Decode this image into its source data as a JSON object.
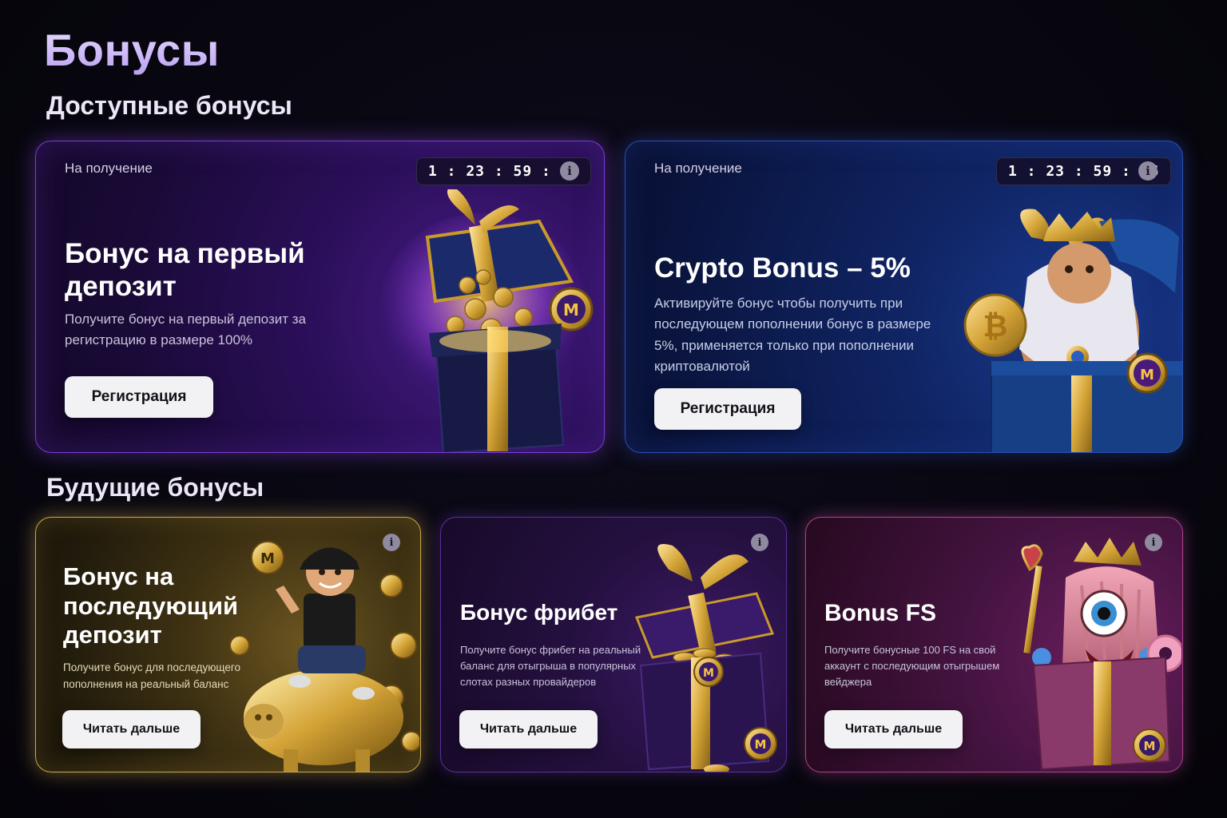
{
  "page": {
    "title": "Бонусы",
    "sections": {
      "available": "Доступные бонусы",
      "future": "Будущие бонусы"
    }
  },
  "available_bonuses": [
    {
      "status": "На получение",
      "timer": "1 : 23 : 59 : 56",
      "title": "Бонус на первый депозит",
      "description": "Получите бонус на первый депозит за регистрацию в размере 100%",
      "button": "Регистрация",
      "art_icon": "gift-box-coins-icon"
    },
    {
      "status": "На получение",
      "timer": "1 : 23 : 59 : 56",
      "title": "Crypto Bonus – 5%",
      "description": "Активируйте бонус чтобы получить при последующем пополнении бонус в размере 5%, применяется только при пополнении криптовалютой",
      "button": "Регистрация",
      "art_icon": "zeus-bitcoin-icon"
    }
  ],
  "future_bonuses": [
    {
      "title": "Бонус на последующий депозит",
      "description": "Получите бонус для последующего пополнения на реальный баланс",
      "button": "Читать дальше",
      "art_icon": "piggy-bank-character-icon"
    },
    {
      "title": "Бонус фрибет",
      "description": "Получите бонус фрибет на реальный баланс для отыгрыша в популярных слотах разных провайдеров",
      "button": "Читать дальше",
      "art_icon": "treasure-gift-box-icon"
    },
    {
      "title": "Bonus FS",
      "description": "Получите  бонусные 100 FS на свой аккаунт с последующим отыгрышем вейджера",
      "button": "Читать дальше",
      "art_icon": "crowned-monster-gift-icon"
    }
  ],
  "colors": {
    "accent_purple": "#7b3fd1",
    "accent_blue": "#2c4fb5",
    "accent_gold": "#c9a84a",
    "accent_pink": "#b0428f",
    "button_bg": "#f2f2f4"
  }
}
